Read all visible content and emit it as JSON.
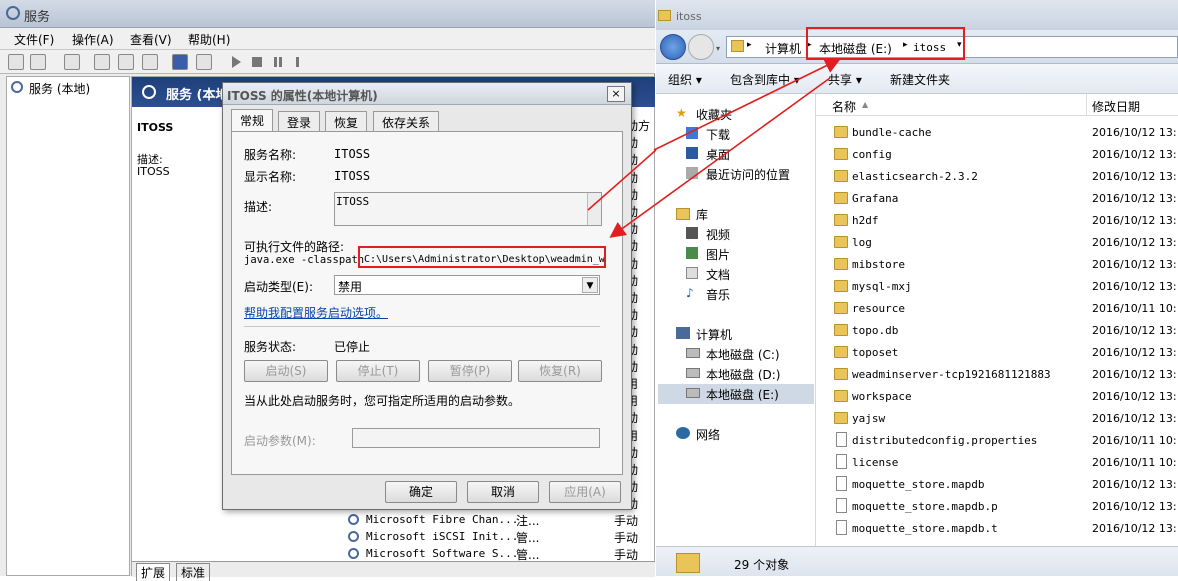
{
  "services_window": {
    "title": "服务",
    "menu": [
      "文件(F)",
      "操作(A)",
      "查看(V)",
      "帮助(H)"
    ],
    "tree_item": "服务 (本地)",
    "main_header": "服务 (本地)",
    "selected_service": "ITOSS",
    "description_label": "描述:",
    "description_value": "ITOSS",
    "visible_rows": [
      {
        "name": "Microsoft Fibre Chan...",
        "desc": "注...",
        "startup": "手动"
      },
      {
        "name": "Microsoft iSCSI Init...",
        "desc": "管...",
        "startup": "手动"
      },
      {
        "name": "Microsoft Software S...",
        "desc": "管...",
        "startup": "手动"
      }
    ],
    "right_col_fragments": [
      "动方",
      "动",
      "动",
      "动",
      "动",
      "动",
      "动",
      "动",
      "动",
      "动",
      "动",
      "动",
      "动",
      "动",
      "动",
      "用",
      "用",
      "动",
      "用",
      "动",
      "动",
      "动",
      "动"
    ],
    "bottom_tabs": [
      "扩展",
      "标准"
    ]
  },
  "dialog": {
    "title": "ITOSS 的属性(本地计算机)",
    "close": "×",
    "tabs": [
      "常规",
      "登录",
      "恢复",
      "依存关系"
    ],
    "service_name_label": "服务名称:",
    "service_name": "ITOSS",
    "display_name_label": "显示名称:",
    "display_name": "ITOSS",
    "description_label": "描述:",
    "description": "ITOSS",
    "path_label": "可执行文件的路径:",
    "path_prefix": "java.exe -classpath",
    "path_highlight": "C:\\Users\\Administrator\\Desktop\\weadmin_w",
    "startup_type_label": "启动类型(E):",
    "startup_type": "禁用",
    "help_link": "帮助我配置服务启动选项。",
    "status_label": "服务状态:",
    "status_value": "已停止",
    "btn_start": "启动(S)",
    "btn_stop": "停止(T)",
    "btn_pause": "暂停(P)",
    "btn_resume": "恢复(R)",
    "start_hint": "当从此处启动服务时，您可指定所适用的启动参数。",
    "start_params_label": "启动参数(M):",
    "start_params_value": "",
    "btn_ok": "确定",
    "btn_cancel": "取消",
    "btn_apply": "应用(A)"
  },
  "explorer": {
    "title": "itoss",
    "breadcrumb": [
      "计算机",
      "本地磁盘 (E:)",
      "itoss"
    ],
    "commands": [
      "组织 ▾",
      "包含到库中 ▾",
      "共享 ▾",
      "新建文件夹"
    ],
    "nav": {
      "favorites": "收藏夹",
      "fav_items": [
        "下载",
        "桌面",
        "最近访问的位置"
      ],
      "libraries": "库",
      "lib_items": [
        "视频",
        "图片",
        "文档",
        "音乐"
      ],
      "computer": "计算机",
      "drives": [
        "本地磁盘 (C:)",
        "本地磁盘 (D:)",
        "本地磁盘 (E:)"
      ],
      "network": "网络"
    },
    "columns": [
      "名称",
      "修改日期"
    ],
    "files": [
      {
        "name": "bundle-cache",
        "type": "folder",
        "date": "2016/10/12 13:"
      },
      {
        "name": "config",
        "type": "folder",
        "date": "2016/10/12 13:"
      },
      {
        "name": "elasticsearch-2.3.2",
        "type": "folder",
        "date": "2016/10/12 13:"
      },
      {
        "name": "Grafana",
        "type": "folder",
        "date": "2016/10/12 13:"
      },
      {
        "name": "h2df",
        "type": "folder",
        "date": "2016/10/12 13:"
      },
      {
        "name": "log",
        "type": "folder",
        "date": "2016/10/12 13:"
      },
      {
        "name": "mibstore",
        "type": "folder",
        "date": "2016/10/12 13:"
      },
      {
        "name": "mysql-mxj",
        "type": "folder",
        "date": "2016/10/12 13:"
      },
      {
        "name": "resource",
        "type": "folder",
        "date": "2016/10/11 10:"
      },
      {
        "name": "topo.db",
        "type": "folder",
        "date": "2016/10/12 13:"
      },
      {
        "name": "toposet",
        "type": "folder",
        "date": "2016/10/12 13:"
      },
      {
        "name": "weadminserver-tcp1921681121883",
        "type": "folder",
        "date": "2016/10/12 13:"
      },
      {
        "name": "workspace",
        "type": "folder",
        "date": "2016/10/12 13:"
      },
      {
        "name": "yajsw",
        "type": "folder",
        "date": "2016/10/12 13:"
      },
      {
        "name": "distributedconfig.properties",
        "type": "file",
        "date": "2016/10/11 10:"
      },
      {
        "name": "license",
        "type": "file",
        "date": "2016/10/11 10:"
      },
      {
        "name": "moquette_store.mapdb",
        "type": "file",
        "date": "2016/10/12 13:"
      },
      {
        "name": "moquette_store.mapdb.p",
        "type": "file",
        "date": "2016/10/12 13:"
      },
      {
        "name": "moquette_store.mapdb.t",
        "type": "file",
        "date": "2016/10/12 13:"
      }
    ],
    "status": "29 个对象"
  },
  "colors": {
    "annotation": "#e02020",
    "link": "#0645ad"
  }
}
